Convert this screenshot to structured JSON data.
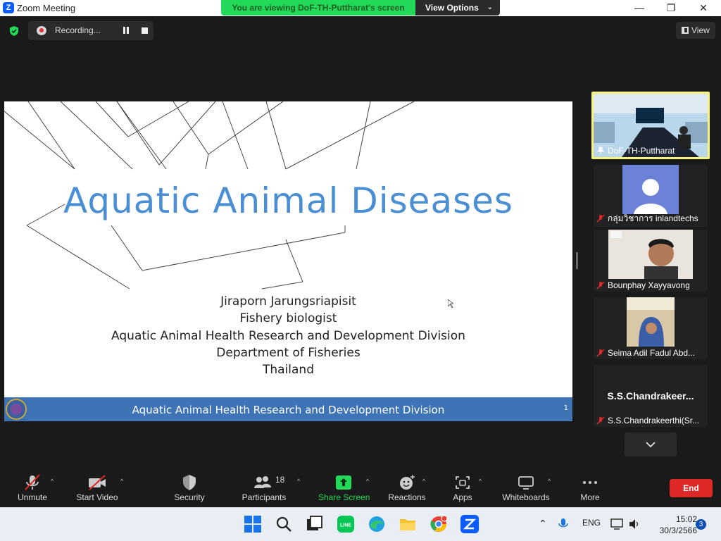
{
  "window": {
    "title": "Zoom Meeting",
    "min_glyph": "—",
    "max_glyph": "❐",
    "close_glyph": "✕"
  },
  "share_banner": {
    "message": "You are viewing DoF-TH-Puttharat's screen",
    "options_label": "View Options"
  },
  "recording": {
    "label": "Recording..."
  },
  "view_button": {
    "label": "View"
  },
  "slide": {
    "title": "Aquatic Animal Diseases",
    "lines": [
      "Jiraporn Jarungsriapisit",
      "Fishery biologist",
      "Aquatic Animal Health Research and Development Division",
      "Department of Fisheries",
      "Thailand"
    ],
    "footer": "Aquatic Animal Health Research and Development Division",
    "page_number": "1"
  },
  "participants_panel": {
    "tiles": [
      {
        "name": "DoF-TH-Puttharat"
      },
      {
        "name": "กลุ่มวิชาการ inlandtechs"
      },
      {
        "name": "Bounphay Xayyavong"
      },
      {
        "name": "Seima Adil Fadul Abd..."
      },
      {
        "name": "S.S.Chandrakeerthi(Sr...",
        "display_name": "S.S.Chandrakeer..."
      }
    ]
  },
  "toolbar": {
    "unmute": "Unmute",
    "start_video": "Start Video",
    "security": "Security",
    "participants": "Participants",
    "participants_count": "18",
    "share_screen": "Share Screen",
    "reactions": "Reactions",
    "apps": "Apps",
    "whiteboards": "Whiteboards",
    "more": "More",
    "end": "End"
  },
  "taskbar": {
    "language": "ENG",
    "time": "15:02",
    "date": "30/3/2566",
    "notifications": "3",
    "line_label": "LINE"
  },
  "colors": {
    "accent_green": "#23d959",
    "end_red": "#e02828",
    "active_border": "#f7f37c",
    "slide_blue": "#4a8fd4"
  }
}
